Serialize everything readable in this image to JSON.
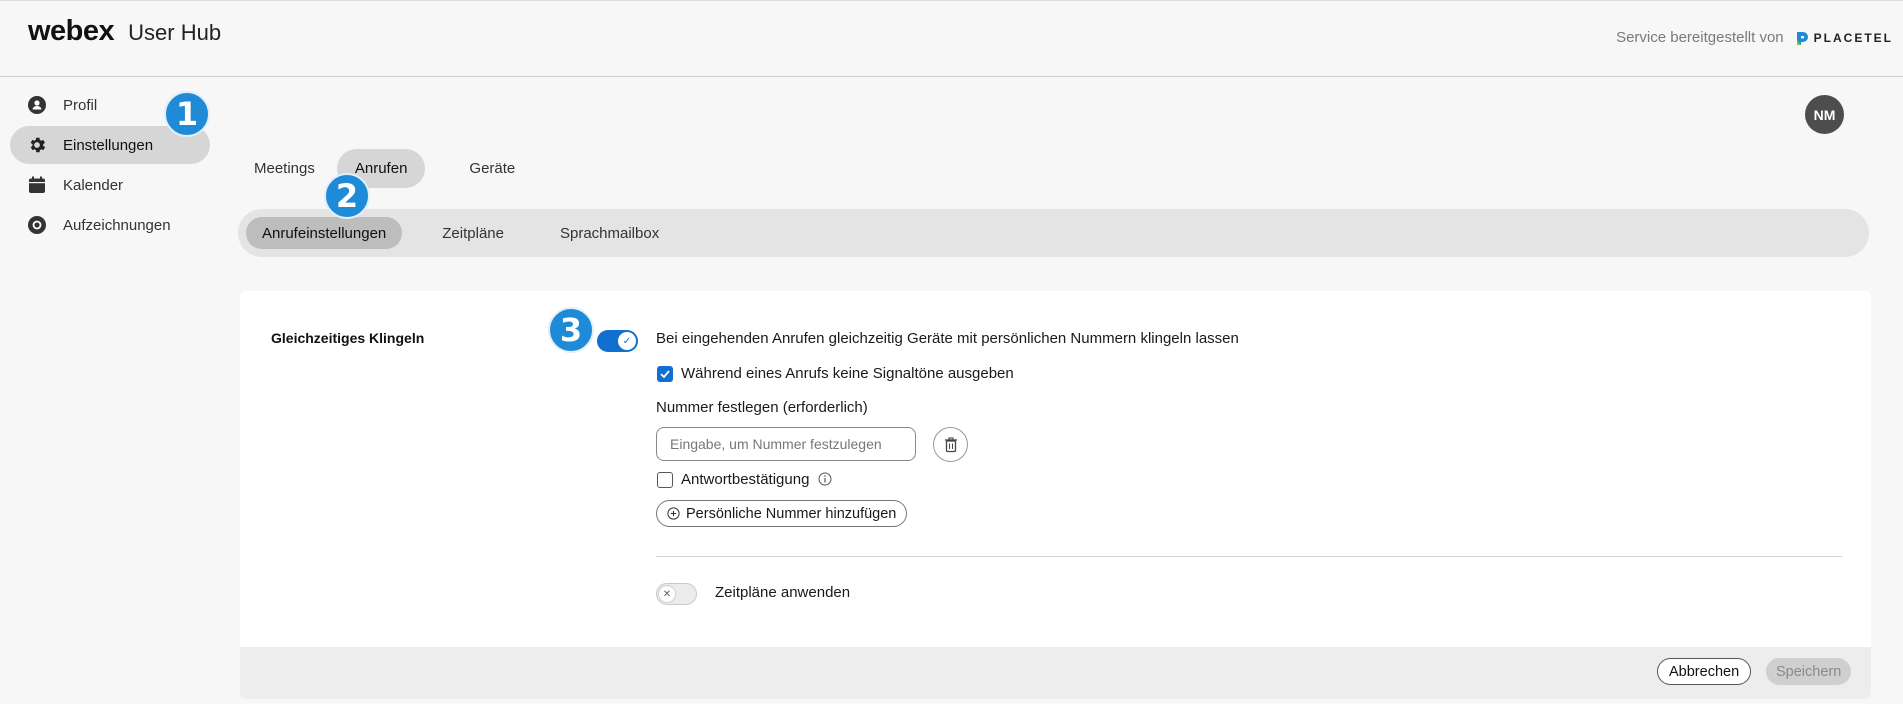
{
  "header": {
    "brand_logo": "webex",
    "app_name": "User Hub",
    "provider_text": "Service bereitgestellt von",
    "provider_name": "PLACETEL"
  },
  "sidebar": {
    "items": [
      {
        "label": "Profil",
        "icon": "profile-icon",
        "active": false
      },
      {
        "label": "Einstellungen",
        "icon": "gear-icon",
        "active": true
      },
      {
        "label": "Kalender",
        "icon": "calendar-icon",
        "active": false
      },
      {
        "label": "Aufzeichnungen",
        "icon": "recording-icon",
        "active": false
      }
    ]
  },
  "user": {
    "initials": "NM"
  },
  "badges": [
    "1",
    "2",
    "3"
  ],
  "tabs": [
    {
      "label": "Meetings",
      "active": false
    },
    {
      "label": "Anrufen",
      "active": true
    },
    {
      "label": "Geräte",
      "active": false
    }
  ],
  "subtabs": [
    {
      "label": "Anrufeinstellungen",
      "active": true
    },
    {
      "label": "Zeitpläne",
      "active": false
    },
    {
      "label": "Sprachmailbox",
      "active": false
    }
  ],
  "settings": {
    "section_title": "Gleichzeitiges Klingeln",
    "ring_toggle_on": true,
    "ring_description": "Bei eingehenden Anrufen gleichzeitig Geräte mit persönlichen Nummern klingeln lassen",
    "no_tones_label": "Während eines Anrufs keine Signaltöne ausgeben",
    "no_tones_checked": true,
    "number_label": "Nummer festlegen (erforderlich)",
    "number_value": "",
    "number_placeholder": "Eingabe, um Nummer festzulegen",
    "answer_confirm_label": "Antwortbestätigung",
    "answer_confirm_checked": false,
    "add_number_label": "Persönliche Nummer hinzufügen",
    "schedules_toggle_on": false,
    "schedules_label": "Zeitpläne anwenden"
  },
  "footer": {
    "cancel_label": "Abbrechen",
    "save_label": "Speichern"
  },
  "colors": {
    "accent": "#1170cf",
    "badge": "#1f8ad6",
    "active_pill": "#d6d6d6"
  }
}
